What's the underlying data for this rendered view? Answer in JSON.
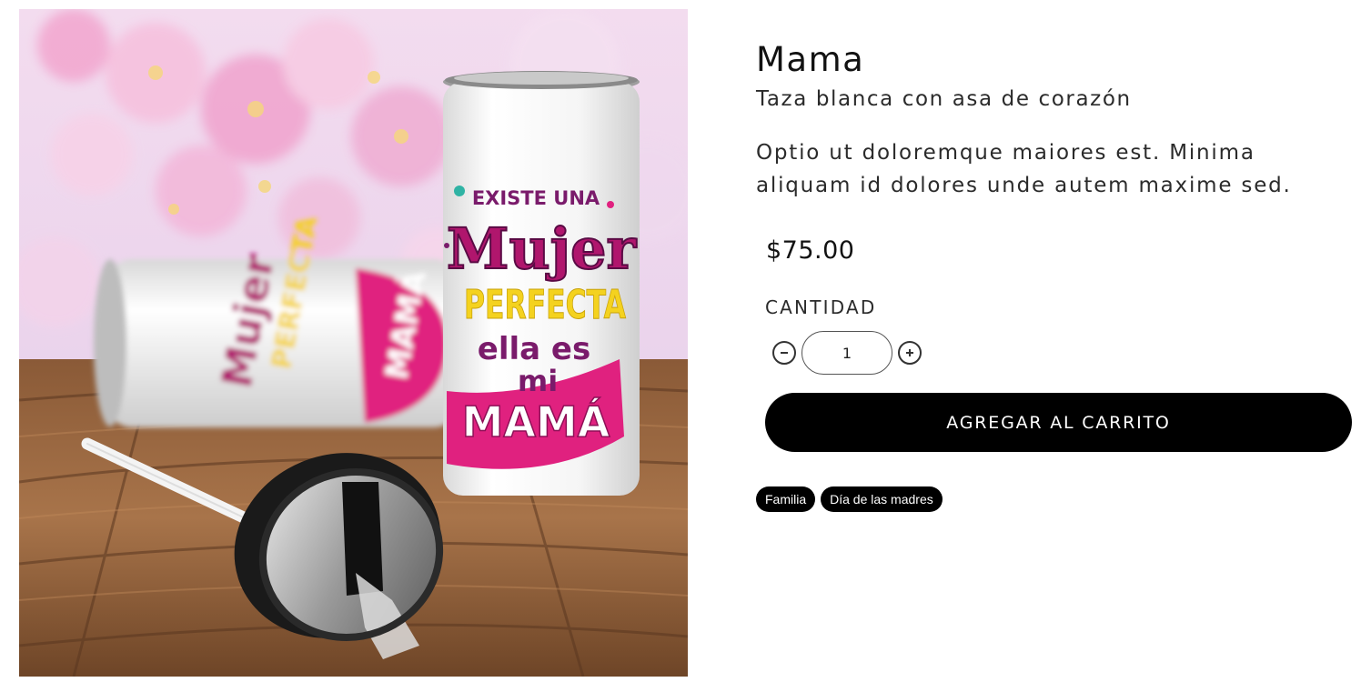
{
  "product": {
    "title": "Mama",
    "subtitle": "Taza blanca con asa de corazón",
    "description": "Optio ut doloremque maiores est. Minima aliquam id dolores unde autem maxime sed.",
    "price": "$75.00",
    "image_text": {
      "line1": "EXISTE UNA",
      "line2": "Mujer",
      "line3": "PERFECTA",
      "line4": "ella es",
      "line5": "mi",
      "line6": "MAMÁ"
    }
  },
  "quantity": {
    "label": "CANTIDAD",
    "value": "1"
  },
  "cart": {
    "add_label": "AGREGAR AL CARRITO"
  },
  "tags": [
    {
      "label": "Familia"
    },
    {
      "label": "Día de las madres"
    }
  ],
  "icons": {
    "decrease": "minus-circle-icon",
    "increase": "plus-circle-icon"
  },
  "colors": {
    "button_bg": "#000000",
    "button_text": "#ffffff",
    "accent_pink": "#e0217f",
    "accent_yellow": "#f4d21f",
    "accent_purple": "#7a1b6b"
  }
}
